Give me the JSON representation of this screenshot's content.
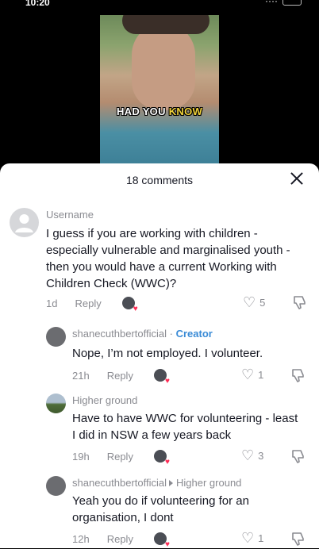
{
  "status_bar": {
    "time": "10:20",
    "signal": "····"
  },
  "video": {
    "caption_plain": "HAD YOU",
    "caption_highlight": "KNOW"
  },
  "sheet": {
    "title": "18 comments"
  },
  "comments": [
    {
      "username": "Username",
      "text": "I guess if you are working with children - especially vulnerable and marginalised youth - then you would have a current Working with Children Check (WWC)?",
      "age": "1d",
      "reply_label": "Reply",
      "likes": "5"
    },
    {
      "username": "shanecuthbertofficial",
      "separator": "·",
      "badge": "Creator",
      "text": "Nope, I’m not employed. I volunteer.",
      "age": "21h",
      "reply_label": "Reply",
      "likes": "1"
    },
    {
      "username": "Higher ground",
      "text": "Have to have WWC for volunteering - least I did in NSW a few years back",
      "age": "19h",
      "reply_label": "Reply",
      "likes": "3"
    },
    {
      "username": "shanecuthbertofficial",
      "reply_to": "Higher ground",
      "text": "Yeah you do if volunteering for an organisation, I dont",
      "age": "12h",
      "reply_label": "Reply",
      "likes": "1"
    }
  ],
  "colors": {
    "accent_like": "#fe2c55",
    "creator_badge": "#3a8bd6",
    "caption_highlight": "#f2d33a"
  }
}
